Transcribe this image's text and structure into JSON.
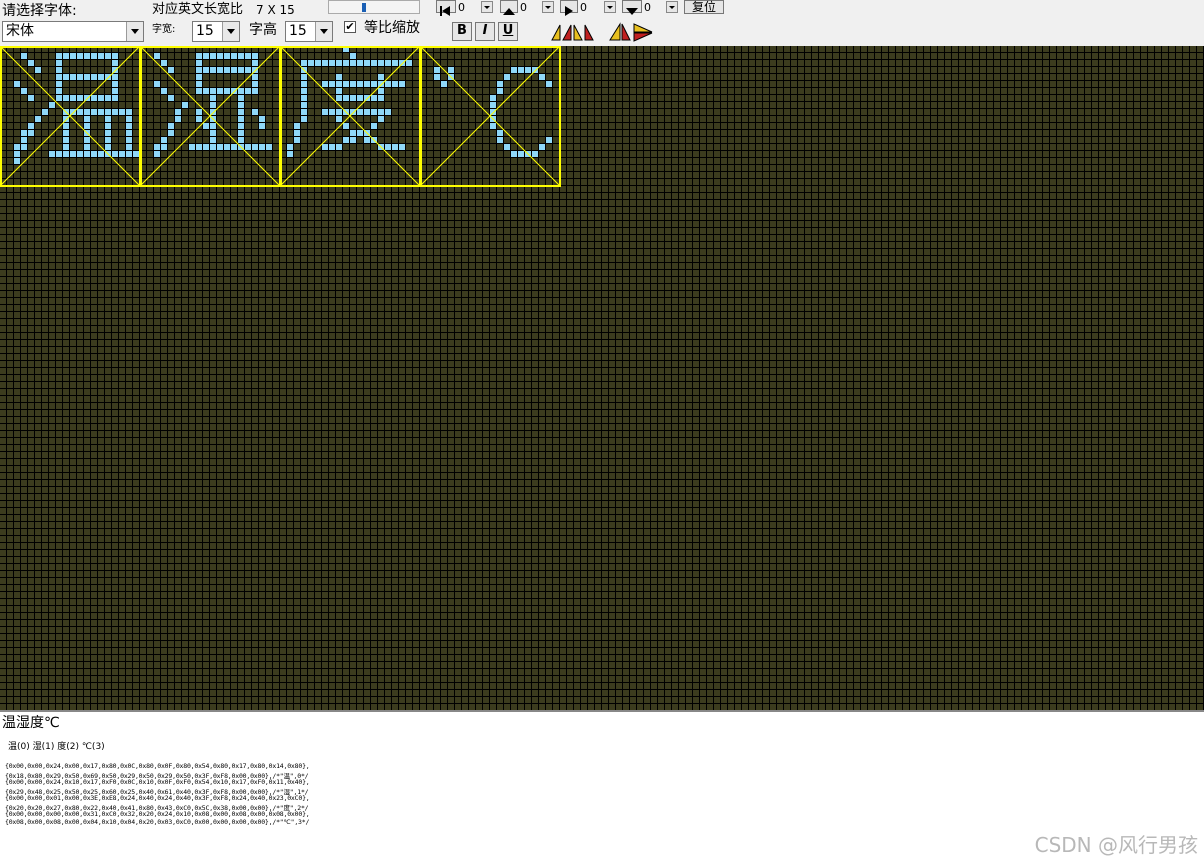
{
  "toolbar": {
    "font_prompt": "请选择字体:",
    "ratio_label": "对应英文长宽比",
    "ratio_value": "7 X 15",
    "font_select": "宋体",
    "width_label": "字宽:",
    "width_value": "15",
    "height_label": "字高",
    "height_value": "15",
    "ratio_checkbox_label": "等比缩放",
    "ratio_checked": "✔",
    "bold_label": "B",
    "italic_label": "I",
    "underline_label": "U",
    "offset_left": "0",
    "offset_up": "0",
    "offset_right": "0",
    "offset_down": "0",
    "reset_label": "复位"
  },
  "grid": {
    "bg_color": "#3c3c1e",
    "line_color": "#000000",
    "pixel_color": "#8fd8f8",
    "frame_color": "#ffff00",
    "glyphs": [
      "温",
      "湿",
      "度",
      "℃"
    ]
  },
  "input_text": "温湿度℃",
  "index_line": "温(0) 湿(1) 度(2) ℃(3)",
  "code_lines": [
    "{0x00,0x00,0x24,0x00,0x17,0x80,0x0C,0x80,0x0F,0x80,0x54,0x80,0x17,0x80,0x14,0x80},",
    "{0x18,0x80,0x29,0x50,0x69,0x50,0x29,0x50,0x29,0x50,0x3F,0xF8,0x00,0x00},/*\"温\",0*/",
    "{0x00,0x00,0x24,0x10,0x17,0xF0,0x0C,0x10,0x0F,0xF0,0x54,0x10,0x17,0xF0,0x11,0x40},",
    "{0x29,0x48,0x25,0x50,0x25,0x60,0x25,0x40,0x61,0x40,0x3F,0xF8,0x00,0x00},/*\"湿\",1*/",
    "{0x00,0x00,0x01,0x00,0x3E,0xE8,0x24,0x40,0x24,0x40,0x3F,0xF8,0x24,0x40,0x23,0xC0},",
    "{0x20,0x20,0x27,0x80,0x22,0x40,0x41,0x80,0x43,0xC0,0x5C,0x38,0x00,0x00},/*\"度\",2*/",
    "{0x00,0x00,0x00,0x00,0x31,0xC0,0x32,0x20,0x24,0x10,0x08,0x00,0x08,0x00,0x08,0x00},",
    "{0x08,0x00,0x08,0x00,0x04,0x10,0x04,0x20,0x03,0xC0,0x00,0x00,0x00,0x00},/*\"℃\",3*/"
  ],
  "watermark": "CSDN @风行男孩"
}
